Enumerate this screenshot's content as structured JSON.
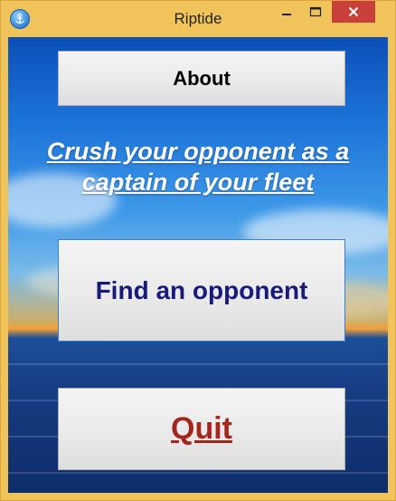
{
  "window": {
    "title": "Riptide",
    "icon": "anchor-icon"
  },
  "controls": {
    "minimize_icon": "minimize-icon",
    "maximize_icon": "maximize-icon",
    "close_icon": "close-icon"
  },
  "main": {
    "about_label": "About",
    "tagline_line1": "Crush your opponent as a",
    "tagline_line2": "captain of your fleet",
    "find_label": "Find an opponent",
    "quit_label": "Quit"
  },
  "colors": {
    "frame": "#f0c45a",
    "close_button": "#c9403a",
    "find_text": "#1a1a7a",
    "quit_text": "#a4261d"
  }
}
